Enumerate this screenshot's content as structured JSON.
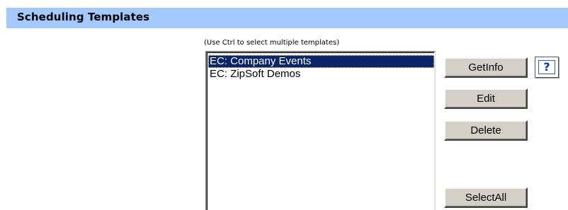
{
  "section": {
    "title": "Scheduling Templates"
  },
  "templates": {
    "hint": "(Use Ctrl to select multiple templates)",
    "items": [
      {
        "label": "EC: Company Events",
        "selected": true
      },
      {
        "label": "EC: ZipSoft Demos",
        "selected": false
      }
    ]
  },
  "buttons": {
    "getinfo_label": "GetInfo",
    "help_label": "?",
    "edit_label": "Edit",
    "delete_label": "Delete",
    "selectall_label": "SelectAll"
  },
  "colors": {
    "header_bg": "#a5c8ff",
    "selection_bg": "#0a246a",
    "button_face": "#d4d0c8",
    "help_icon": "#0033cc"
  }
}
